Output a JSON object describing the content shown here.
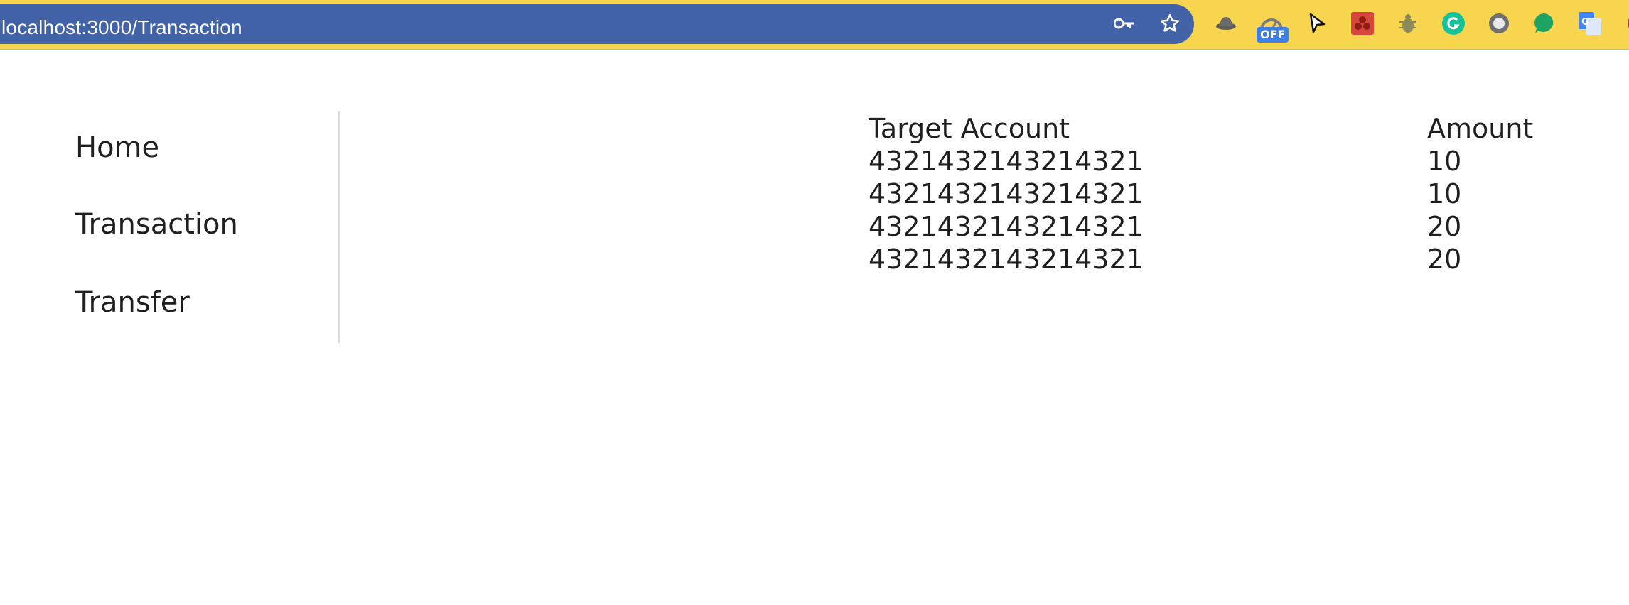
{
  "browser": {
    "url": "localhost:3000/Transaction",
    "omnibox_icons": [
      "key-icon",
      "star-icon"
    ],
    "extensions": [
      {
        "name": "hat-extension-icon",
        "color": "#6b6b6b"
      },
      {
        "name": "speed-extension-icon",
        "color": "#7a7a7a",
        "badge": "OFF"
      },
      {
        "name": "cursor-extension-icon",
        "color": "#111111"
      },
      {
        "name": "red-extension-icon",
        "color": "#d6463b"
      },
      {
        "name": "bug-extension-icon",
        "color": "#8a8a5a"
      },
      {
        "name": "grammarly-icon",
        "color": "#15c39a"
      },
      {
        "name": "gray-circle-extension-icon",
        "color": "#6f6f6f"
      },
      {
        "name": "green-bubble-extension-icon",
        "color": "#1ea362"
      },
      {
        "name": "translate-extension-icon",
        "color": "#4285f4"
      }
    ]
  },
  "sidebar": {
    "items": [
      {
        "label": "Home"
      },
      {
        "label": "Transaction"
      },
      {
        "label": "Transfer"
      }
    ]
  },
  "table": {
    "headers": {
      "account": "Target Account",
      "amount": "Amount"
    },
    "rows": [
      {
        "account": "4321432143214321",
        "amount": "10"
      },
      {
        "account": "4321432143214321",
        "amount": "10"
      },
      {
        "account": "4321432143214321",
        "amount": "20"
      },
      {
        "account": "4321432143214321",
        "amount": "20"
      }
    ]
  }
}
